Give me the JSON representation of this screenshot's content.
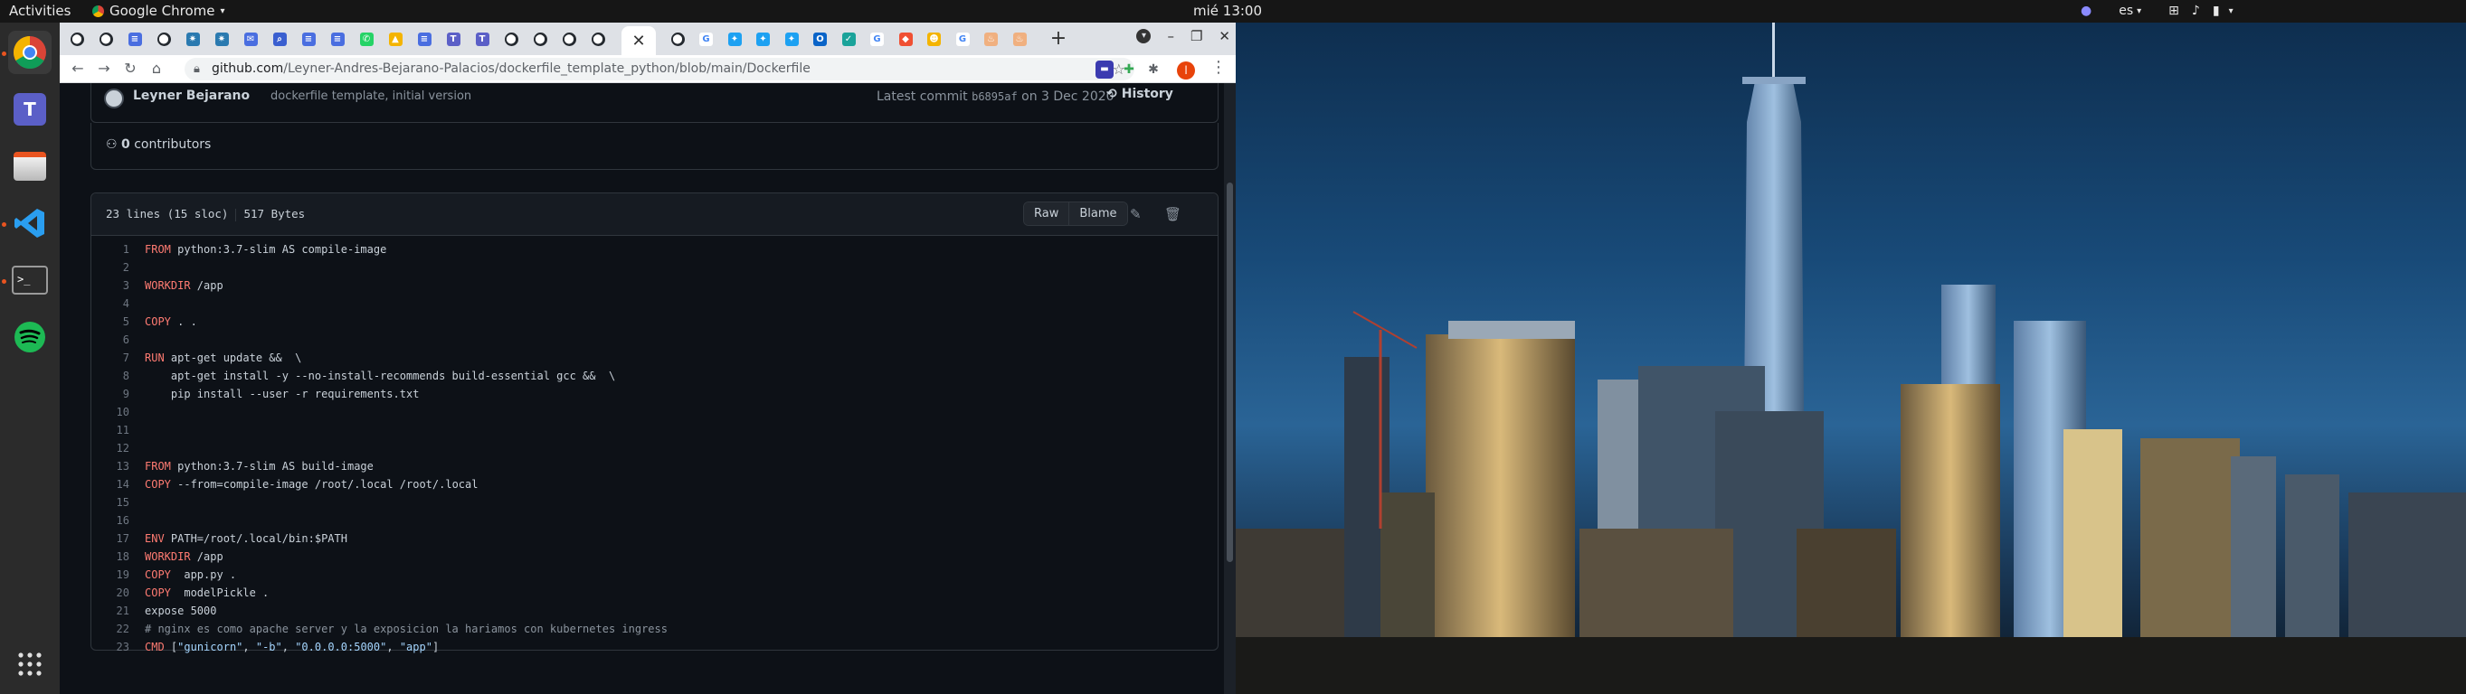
{
  "topbar": {
    "activities": "Activities",
    "app_name": "Google Chrome",
    "clock": "mié 13:00",
    "lang": "es"
  },
  "dock": {
    "items": [
      "chrome-icon",
      "teams-icon",
      "files-icon",
      "vscode-icon",
      "terminal-icon",
      "spotify-icon",
      "app-grid-icon"
    ]
  },
  "browser": {
    "tabs": [
      {
        "icon": "github-icon"
      },
      {
        "icon": "github-icon"
      },
      {
        "icon": "docs-icon"
      },
      {
        "icon": "github-icon"
      },
      {
        "icon": "pinwheel-icon"
      },
      {
        "icon": "pinwheel-icon"
      },
      {
        "icon": "mail-icon"
      },
      {
        "icon": "search-icon"
      },
      {
        "icon": "docs-icon"
      },
      {
        "icon": "docs-icon"
      },
      {
        "icon": "whatsapp-icon"
      },
      {
        "icon": "drive-icon"
      },
      {
        "icon": "docs-icon"
      },
      {
        "icon": "teams-icon"
      },
      {
        "icon": "teams-icon"
      },
      {
        "icon": "github-icon"
      },
      {
        "icon": "github-icon"
      },
      {
        "icon": "github-icon"
      },
      {
        "icon": "github-icon"
      }
    ],
    "tabs_right": [
      {
        "icon": "github-icon"
      },
      {
        "icon": "google-icon"
      },
      {
        "icon": "twitter-icon"
      },
      {
        "icon": "twitter-icon"
      },
      {
        "icon": "twitter-icon"
      },
      {
        "icon": "outlook-icon"
      },
      {
        "icon": "store-icon"
      },
      {
        "icon": "google-icon"
      },
      {
        "icon": "git-icon"
      },
      {
        "icon": "ext-icon"
      },
      {
        "icon": "google-icon"
      },
      {
        "icon": "python-icon"
      },
      {
        "icon": "python-icon"
      }
    ],
    "url_host": "github.com",
    "url_path": "/Leyner-Andres-Bejarano-Palacios/dockerfile_template_python/blob/main/Dockerfile",
    "profile_initial": "l"
  },
  "commit": {
    "author": "Leyner Bejarano",
    "message": "dockerfile template, initial version",
    "latest_prefix": "Latest commit",
    "sha": "b6895af",
    "date_text": "on 3 Dec 2020",
    "history_label": "History"
  },
  "contributors": {
    "count": "0",
    "label": "contributors"
  },
  "file": {
    "lines_info": "23 lines (15 sloc)",
    "size": "517 Bytes",
    "raw_label": "Raw",
    "blame_label": "Blame"
  },
  "code_lines": [
    {
      "n": "1",
      "kw": "FROM",
      "rest": " python:3.7-slim AS compile-image"
    },
    {
      "n": "2",
      "kw": "",
      "rest": ""
    },
    {
      "n": "3",
      "kw": "WORKDIR",
      "rest": " /app"
    },
    {
      "n": "4",
      "kw": "",
      "rest": ""
    },
    {
      "n": "5",
      "kw": "COPY",
      "rest": " . ."
    },
    {
      "n": "6",
      "kw": "",
      "rest": ""
    },
    {
      "n": "7",
      "kw": "RUN",
      "rest": " apt-get update &&  \\"
    },
    {
      "n": "8",
      "kw": "",
      "rest": "    apt-get install -y --no-install-recommends build-essential gcc &&  \\"
    },
    {
      "n": "9",
      "kw": "",
      "rest": "    pip install --user -r requirements.txt"
    },
    {
      "n": "10",
      "kw": "",
      "rest": ""
    },
    {
      "n": "11",
      "kw": "",
      "rest": ""
    },
    {
      "n": "12",
      "kw": "",
      "rest": ""
    },
    {
      "n": "13",
      "kw": "FROM",
      "rest": " python:3.7-slim AS build-image"
    },
    {
      "n": "14",
      "kw": "COPY",
      "rest": " --from=compile-image /root/.local /root/.local"
    },
    {
      "n": "15",
      "kw": "",
      "rest": ""
    },
    {
      "n": "16",
      "kw": "",
      "rest": ""
    },
    {
      "n": "17",
      "kw": "ENV",
      "rest": " PATH=/root/.local/bin:$PATH"
    },
    {
      "n": "18",
      "kw": "WORKDIR",
      "rest": " /app"
    },
    {
      "n": "19",
      "kw": "COPY",
      "rest": "  app.py ."
    },
    {
      "n": "20",
      "kw": "COPY",
      "rest": "  modelPickle ."
    },
    {
      "n": "21",
      "kw": "",
      "rest": "expose 5000"
    },
    {
      "n": "22",
      "kw": "",
      "rest": "# nginx es como apache server y la exposicion la hariamos con kubernetes ingress",
      "comment": true
    },
    {
      "n": "23",
      "kw": "CMD",
      "rest": " [\"gunicorn\", \"-b\", \"0.0.0.0:5000\", \"app\"]",
      "string": true
    }
  ]
}
